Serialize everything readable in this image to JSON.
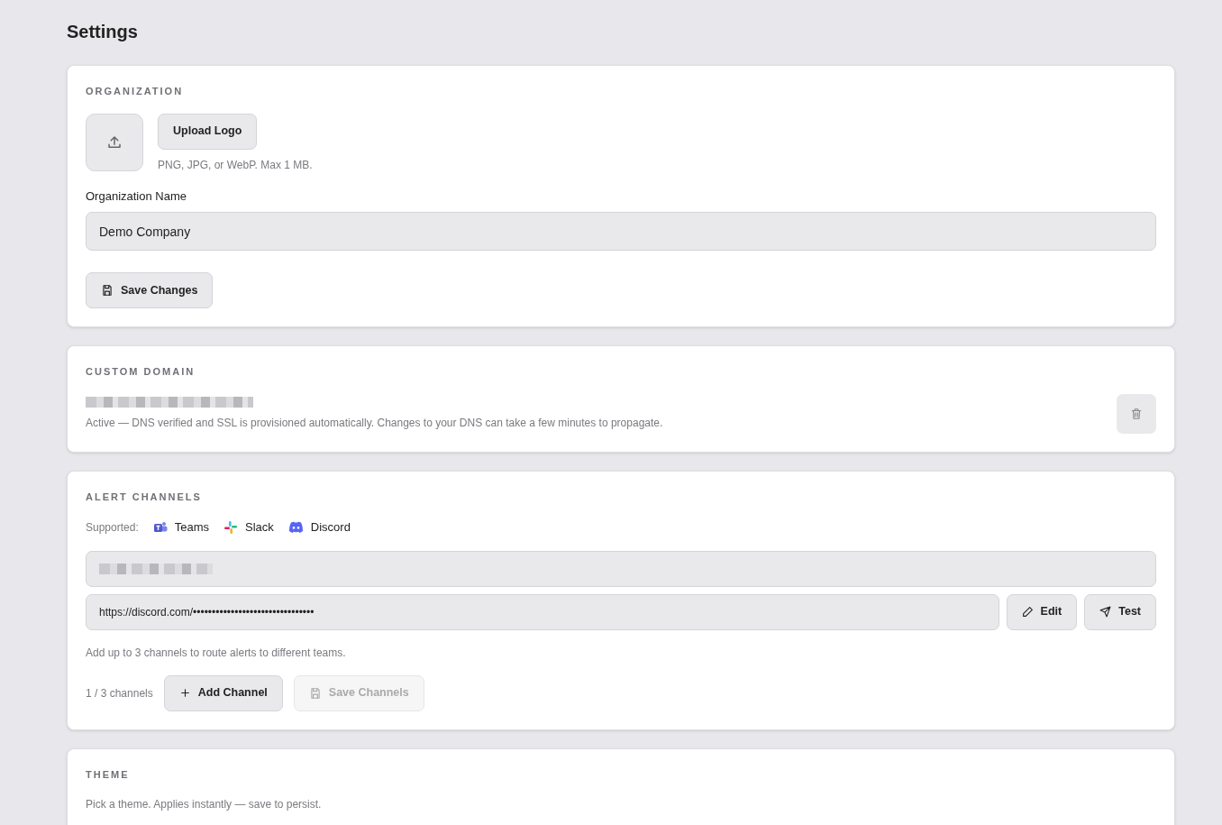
{
  "page_title": "Settings",
  "organization": {
    "heading": "ORGANIZATION",
    "upload_button": "Upload Logo",
    "upload_hint": "PNG, JPG, or WebP. Max 1 MB.",
    "name_label": "Organization Name",
    "name_value": "Demo Company",
    "save_button": "Save Changes"
  },
  "custom_domain": {
    "heading": "CUSTOM DOMAIN",
    "status_text": "Active — DNS verified and SSL is provisioned automatically. Changes to your DNS can take a few minutes to propagate."
  },
  "alert_channels": {
    "heading": "ALERT CHANNELS",
    "supported_label": "Supported:",
    "providers": [
      {
        "kind": "teams",
        "label": "Teams"
      },
      {
        "kind": "slack",
        "label": "Slack"
      },
      {
        "kind": "discord",
        "label": "Discord"
      }
    ],
    "webhook_value": "https://discord.com/••••••••••••••••••••••••••••••••",
    "edit_button": "Edit",
    "test_button": "Test",
    "hint": "Add up to 3 channels to route alerts to different teams.",
    "count": "1 / 3 channels",
    "add_button": "Add Channel",
    "save_button": {
      "label": "Save Channels",
      "disabled": true
    }
  },
  "theme": {
    "heading": "THEME",
    "hint": "Pick a theme. Applies instantly — save to persist."
  }
}
